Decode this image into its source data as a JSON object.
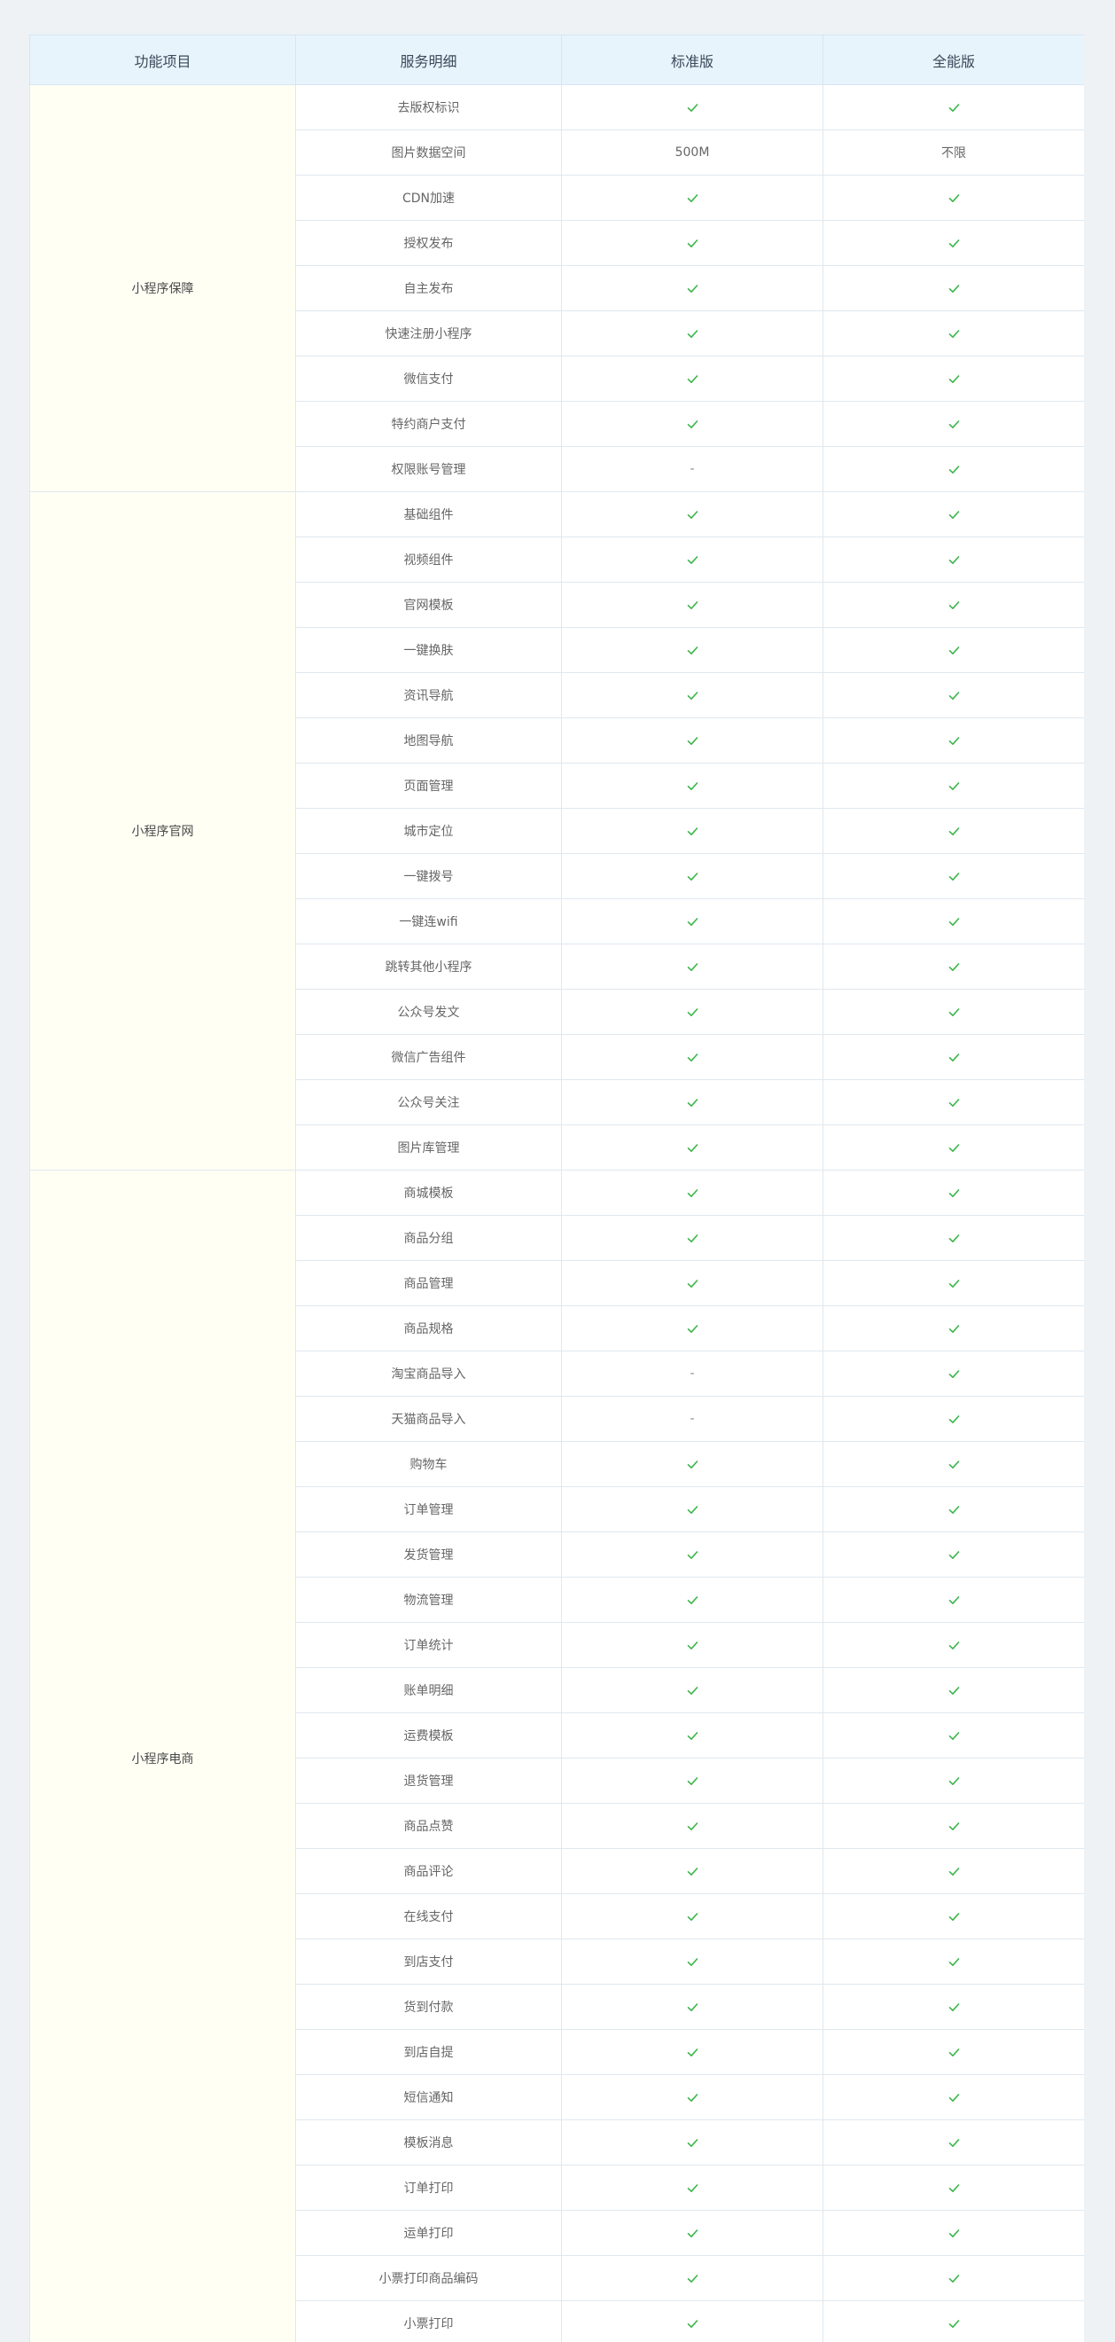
{
  "columns": [
    "功能项目",
    "服务明细",
    "标准版",
    "全能版"
  ],
  "colors": {
    "check": "#3bb54a",
    "header_bg": "#e8f4fc",
    "category_bg": "#fffff4"
  },
  "sections": [
    {
      "name": "小程序保障",
      "rows": [
        {
          "item": "去版权标识",
          "standard": "check",
          "full": "check"
        },
        {
          "item": "图片数据空间",
          "standard": "500M",
          "full": "不限"
        },
        {
          "item": "CDN加速",
          "standard": "check",
          "full": "check"
        },
        {
          "item": "授权发布",
          "standard": "check",
          "full": "check"
        },
        {
          "item": "自主发布",
          "standard": "check",
          "full": "check"
        },
        {
          "item": "快速注册小程序",
          "standard": "check",
          "full": "check"
        },
        {
          "item": "微信支付",
          "standard": "check",
          "full": "check"
        },
        {
          "item": "特约商户支付",
          "standard": "check",
          "full": "check"
        },
        {
          "item": "权限账号管理",
          "standard": "-",
          "full": "check"
        }
      ]
    },
    {
      "name": "小程序官网",
      "rows": [
        {
          "item": "基础组件",
          "standard": "check",
          "full": "check"
        },
        {
          "item": "视频组件",
          "standard": "check",
          "full": "check"
        },
        {
          "item": "官网模板",
          "standard": "check",
          "full": "check"
        },
        {
          "item": "一键换肤",
          "standard": "check",
          "full": "check"
        },
        {
          "item": "资讯导航",
          "standard": "check",
          "full": "check"
        },
        {
          "item": "地图导航",
          "standard": "check",
          "full": "check"
        },
        {
          "item": "页面管理",
          "standard": "check",
          "full": "check"
        },
        {
          "item": "城市定位",
          "standard": "check",
          "full": "check"
        },
        {
          "item": "一键拨号",
          "standard": "check",
          "full": "check"
        },
        {
          "item": "一键连wifi",
          "standard": "check",
          "full": "check"
        },
        {
          "item": "跳转其他小程序",
          "standard": "check",
          "full": "check"
        },
        {
          "item": "公众号发文",
          "standard": "check",
          "full": "check"
        },
        {
          "item": "微信广告组件",
          "standard": "check",
          "full": "check"
        },
        {
          "item": "公众号关注",
          "standard": "check",
          "full": "check"
        },
        {
          "item": "图片库管理",
          "standard": "check",
          "full": "check"
        }
      ]
    },
    {
      "name": "小程序电商",
      "rows": [
        {
          "item": "商城模板",
          "standard": "check",
          "full": "check"
        },
        {
          "item": "商品分组",
          "standard": "check",
          "full": "check"
        },
        {
          "item": "商品管理",
          "standard": "check",
          "full": "check"
        },
        {
          "item": "商品规格",
          "standard": "check",
          "full": "check"
        },
        {
          "item": "淘宝商品导入",
          "standard": "-",
          "full": "check"
        },
        {
          "item": "天猫商品导入",
          "standard": "-",
          "full": "check"
        },
        {
          "item": "购物车",
          "standard": "check",
          "full": "check"
        },
        {
          "item": "订单管理",
          "standard": "check",
          "full": "check"
        },
        {
          "item": "发货管理",
          "standard": "check",
          "full": "check"
        },
        {
          "item": "物流管理",
          "standard": "check",
          "full": "check"
        },
        {
          "item": "订单统计",
          "standard": "check",
          "full": "check"
        },
        {
          "item": "账单明细",
          "standard": "check",
          "full": "check"
        },
        {
          "item": "运费模板",
          "standard": "check",
          "full": "check"
        },
        {
          "item": "退货管理",
          "standard": "check",
          "full": "check"
        },
        {
          "item": "商品点赞",
          "standard": "check",
          "full": "check"
        },
        {
          "item": "商品评论",
          "standard": "check",
          "full": "check"
        },
        {
          "item": "在线支付",
          "standard": "check",
          "full": "check"
        },
        {
          "item": "到店支付",
          "standard": "check",
          "full": "check"
        },
        {
          "item": "货到付款",
          "standard": "check",
          "full": "check"
        },
        {
          "item": "到店自提",
          "standard": "check",
          "full": "check"
        },
        {
          "item": "短信通知",
          "standard": "check",
          "full": "check"
        },
        {
          "item": "模板消息",
          "standard": "check",
          "full": "check"
        },
        {
          "item": "订单打印",
          "standard": "check",
          "full": "check"
        },
        {
          "item": "运单打印",
          "standard": "check",
          "full": "check"
        },
        {
          "item": "小票打印商品编码",
          "standard": "check",
          "full": "check"
        },
        {
          "item": "小票打印",
          "standard": "check",
          "full": "check"
        }
      ]
    }
  ]
}
